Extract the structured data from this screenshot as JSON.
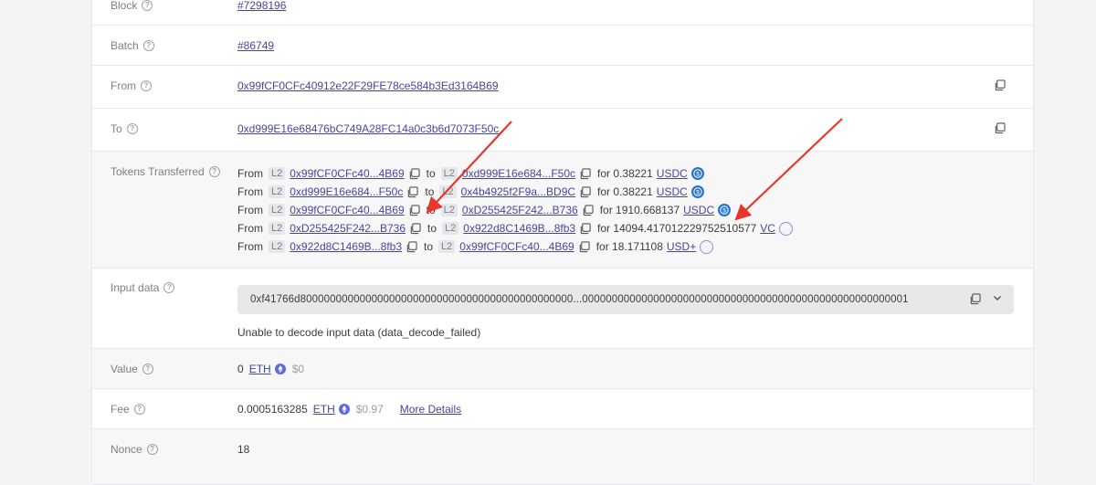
{
  "rows": {
    "block": {
      "label": "Block",
      "value": "#7298196"
    },
    "batch": {
      "label": "Batch",
      "value": "#86749"
    },
    "from": {
      "label": "From",
      "value": "0x99fCF0CFc40912e22F29FE78ce584b3Ed3164B69"
    },
    "to": {
      "label": "To",
      "value": "0xd999E16e68476bC749A28FC14a0c3b6d7073F50c"
    },
    "tokens": {
      "label": "Tokens Transferred",
      "from_word": "From",
      "to_word": "to",
      "for_word": "for",
      "l2": "L2",
      "transfers": [
        {
          "from": "0x99fCF0CFc40...4B69",
          "to": "0xd999E16e684...F50c",
          "amount": "0.38221",
          "token": "USDC",
          "icon": "usdc-coin-icon"
        },
        {
          "from": "0xd999E16e684...F50c",
          "to": "0x4b4925f2F9a...BD9C",
          "amount": "0.38221",
          "token": "USDC",
          "icon": "usdc-coin-icon"
        },
        {
          "from": "0x99fCF0CFc40...4B69",
          "to": "0xD255425F242...B736",
          "amount": "1910.668137",
          "token": "USDC",
          "icon": "usdc-coin-icon"
        },
        {
          "from": "0xD255425F242...B736",
          "to": "0x922d8C1469B...8fb3",
          "amount": "14094.417012229752510577",
          "token": "VC",
          "icon": "generic-coin-icon"
        },
        {
          "from": "0x922d8C1469B...8fb3",
          "to": "0x99fCF0CFc40...4B69",
          "amount": "18.171108",
          "token": "USD+",
          "icon": "generic-coin-icon"
        }
      ]
    },
    "input": {
      "label": "Input data",
      "hex": "0xf41766d8000000000000000000000000000000000000000000000...0000000000000000000000000000000000000000000000000000001",
      "decode_message": "Unable to decode input data (data_decode_failed)"
    },
    "value": {
      "label": "Value",
      "amount": "0",
      "token": "ETH",
      "usd": "$0"
    },
    "fee": {
      "label": "Fee",
      "amount": "0.0005163285",
      "token": "ETH",
      "usd": "$0.97",
      "more": "More Details"
    },
    "nonce": {
      "label": "Nonce",
      "value": "18"
    }
  },
  "colors": {
    "link": "#45479d",
    "annotation_arrow": "#e8362b",
    "usdc": "#2775ca"
  }
}
